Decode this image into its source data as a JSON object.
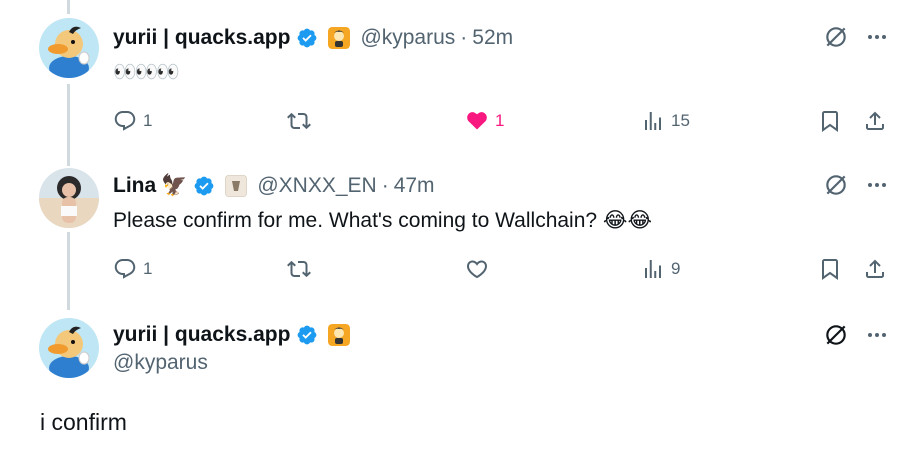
{
  "tweets": [
    {
      "name": "yurii | quacks.app",
      "handle": "@kyparus",
      "time": "52m",
      "text": "👀👀👀",
      "replies": "1",
      "likes": "1",
      "liked": true,
      "views": "15"
    },
    {
      "name": "Lina",
      "name_emoji": "🦅",
      "handle": "@XNXX_EN",
      "time": "47m",
      "text": "Please confirm for me. What's coming to Wallchain? 😂😂",
      "replies": "1",
      "likes": "",
      "liked": false,
      "views": "9"
    }
  ],
  "main_tweet": {
    "name": "yurii | quacks.app",
    "handle": "@kyparus",
    "text": "i confirm"
  },
  "dot_separator": "·",
  "colors": {
    "verified_blue": "#1d9bf0",
    "like_pink": "#f91880",
    "muted_text": "#536471",
    "thread_line": "#cfd9de",
    "affiliate_badge": "#f5a623"
  },
  "icons": {
    "reply": "reply-icon",
    "repost": "repost-icon",
    "like": "heart-icon",
    "views": "views-icon",
    "bookmark": "bookmark-icon",
    "share": "share-icon",
    "grok": "grok-icon",
    "more": "more-icon"
  }
}
